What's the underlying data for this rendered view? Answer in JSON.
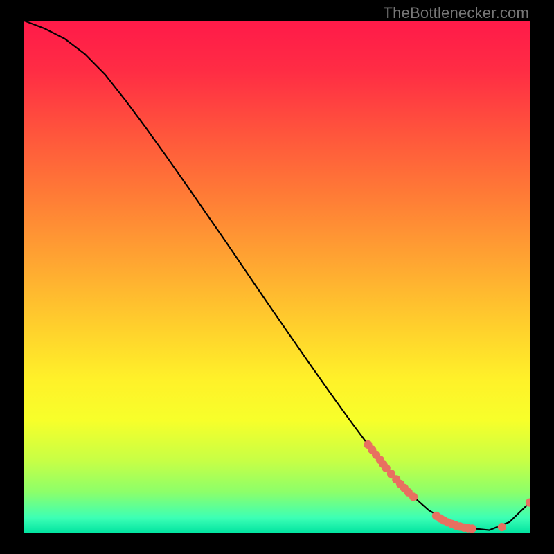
{
  "watermark": "TheBottlenecker.com",
  "colors": {
    "dot": "#e87060",
    "curve": "#000000",
    "background": "#000000"
  },
  "chart_data": {
    "type": "line",
    "title": "",
    "xlabel": "",
    "ylabel": "",
    "xlim": [
      0,
      100
    ],
    "ylim": [
      0,
      100
    ],
    "grid": false,
    "legend": false,
    "series": [
      {
        "name": "curve",
        "x": [
          0,
          4,
          8,
          12,
          16,
          20,
          24,
          28,
          32,
          36,
          40,
          44,
          48,
          52,
          56,
          60,
          64,
          68,
          72,
          76,
          80,
          84,
          88,
          92,
          96,
          100
        ],
        "y": [
          100,
          98.5,
          96.5,
          93.5,
          89.5,
          84.5,
          79.2,
          73.7,
          68.1,
          62.4,
          56.7,
          50.9,
          45.1,
          39.4,
          33.7,
          28.1,
          22.6,
          17.3,
          12.3,
          8.0,
          4.5,
          2.2,
          1.0,
          0.6,
          2.2,
          6.0
        ]
      }
    ],
    "points": [
      {
        "name": "cluster-upper",
        "items": [
          {
            "x": 68.0,
            "y": 17.3
          },
          {
            "x": 68.8,
            "y": 16.3
          },
          {
            "x": 69.6,
            "y": 15.3
          },
          {
            "x": 70.4,
            "y": 14.3
          },
          {
            "x": 71.0,
            "y": 13.5
          },
          {
            "x": 71.6,
            "y": 12.7
          },
          {
            "x": 72.6,
            "y": 11.6
          },
          {
            "x": 73.6,
            "y": 10.5
          },
          {
            "x": 74.4,
            "y": 9.6
          },
          {
            "x": 75.2,
            "y": 8.8
          },
          {
            "x": 76.0,
            "y": 8.0
          },
          {
            "x": 77.0,
            "y": 7.1
          }
        ]
      },
      {
        "name": "cluster-valley",
        "items": [
          {
            "x": 81.5,
            "y": 3.4
          },
          {
            "x": 82.3,
            "y": 2.9
          },
          {
            "x": 83.0,
            "y": 2.5
          },
          {
            "x": 83.8,
            "y": 2.1
          },
          {
            "x": 84.6,
            "y": 1.8
          },
          {
            "x": 85.4,
            "y": 1.5
          },
          {
            "x": 86.2,
            "y": 1.3
          },
          {
            "x": 87.0,
            "y": 1.1
          },
          {
            "x": 87.8,
            "y": 1.0
          },
          {
            "x": 88.6,
            "y": 0.9
          }
        ]
      },
      {
        "name": "cluster-right",
        "items": [
          {
            "x": 94.5,
            "y": 1.2
          }
        ]
      },
      {
        "name": "cluster-end",
        "items": [
          {
            "x": 100.0,
            "y": 6.0
          }
        ]
      }
    ]
  }
}
